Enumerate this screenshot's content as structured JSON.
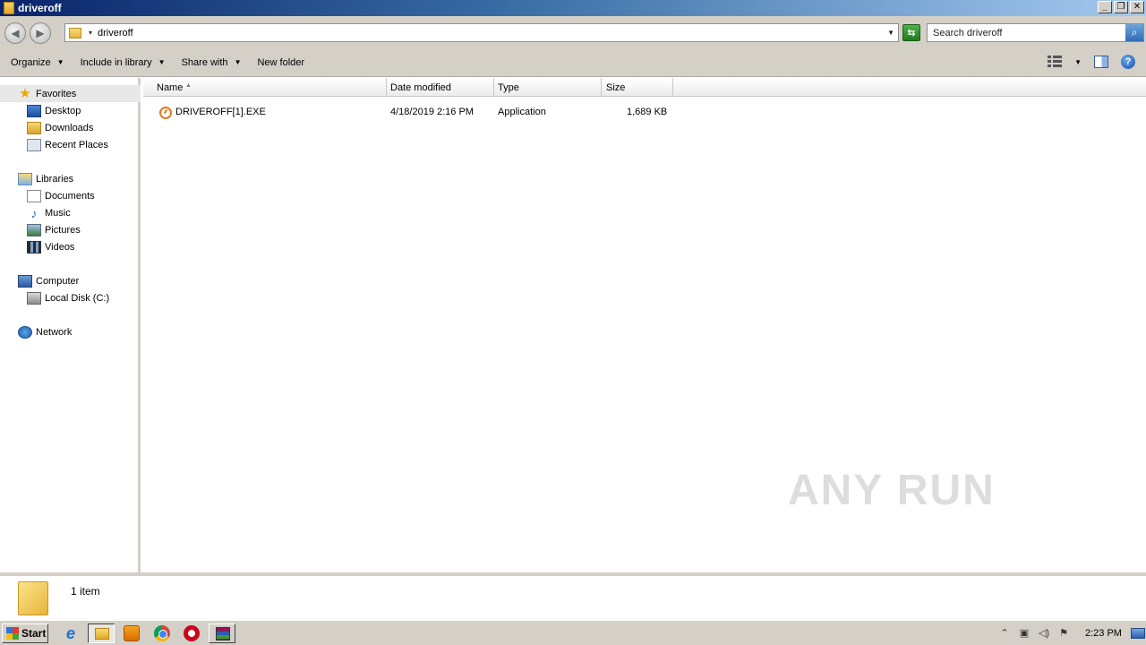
{
  "window": {
    "title": "driveroff"
  },
  "address": {
    "path": "driveroff",
    "search_placeholder": "Search driveroff"
  },
  "toolbar": {
    "organize": "Organize",
    "include_in_library": "Include in library",
    "share_with": "Share with",
    "new_folder": "New folder"
  },
  "nav": {
    "favorites": "Favorites",
    "desktop": "Desktop",
    "downloads": "Downloads",
    "recent_places": "Recent Places",
    "libraries": "Libraries",
    "documents": "Documents",
    "music": "Music",
    "pictures": "Pictures",
    "videos": "Videos",
    "computer": "Computer",
    "local_disk": "Local Disk (C:)",
    "network": "Network"
  },
  "columns": {
    "name": "Name",
    "date_modified": "Date modified",
    "type": "Type",
    "size": "Size"
  },
  "files": [
    {
      "name": "DRIVEROFF[1].EXE",
      "date_modified": "4/18/2019 2:16 PM",
      "type": "Application",
      "size": "1,689 KB"
    }
  ],
  "details": {
    "count": "1 item"
  },
  "watermark": "ANY RUN",
  "taskbar": {
    "start": "Start",
    "clock": "2:23 PM"
  }
}
